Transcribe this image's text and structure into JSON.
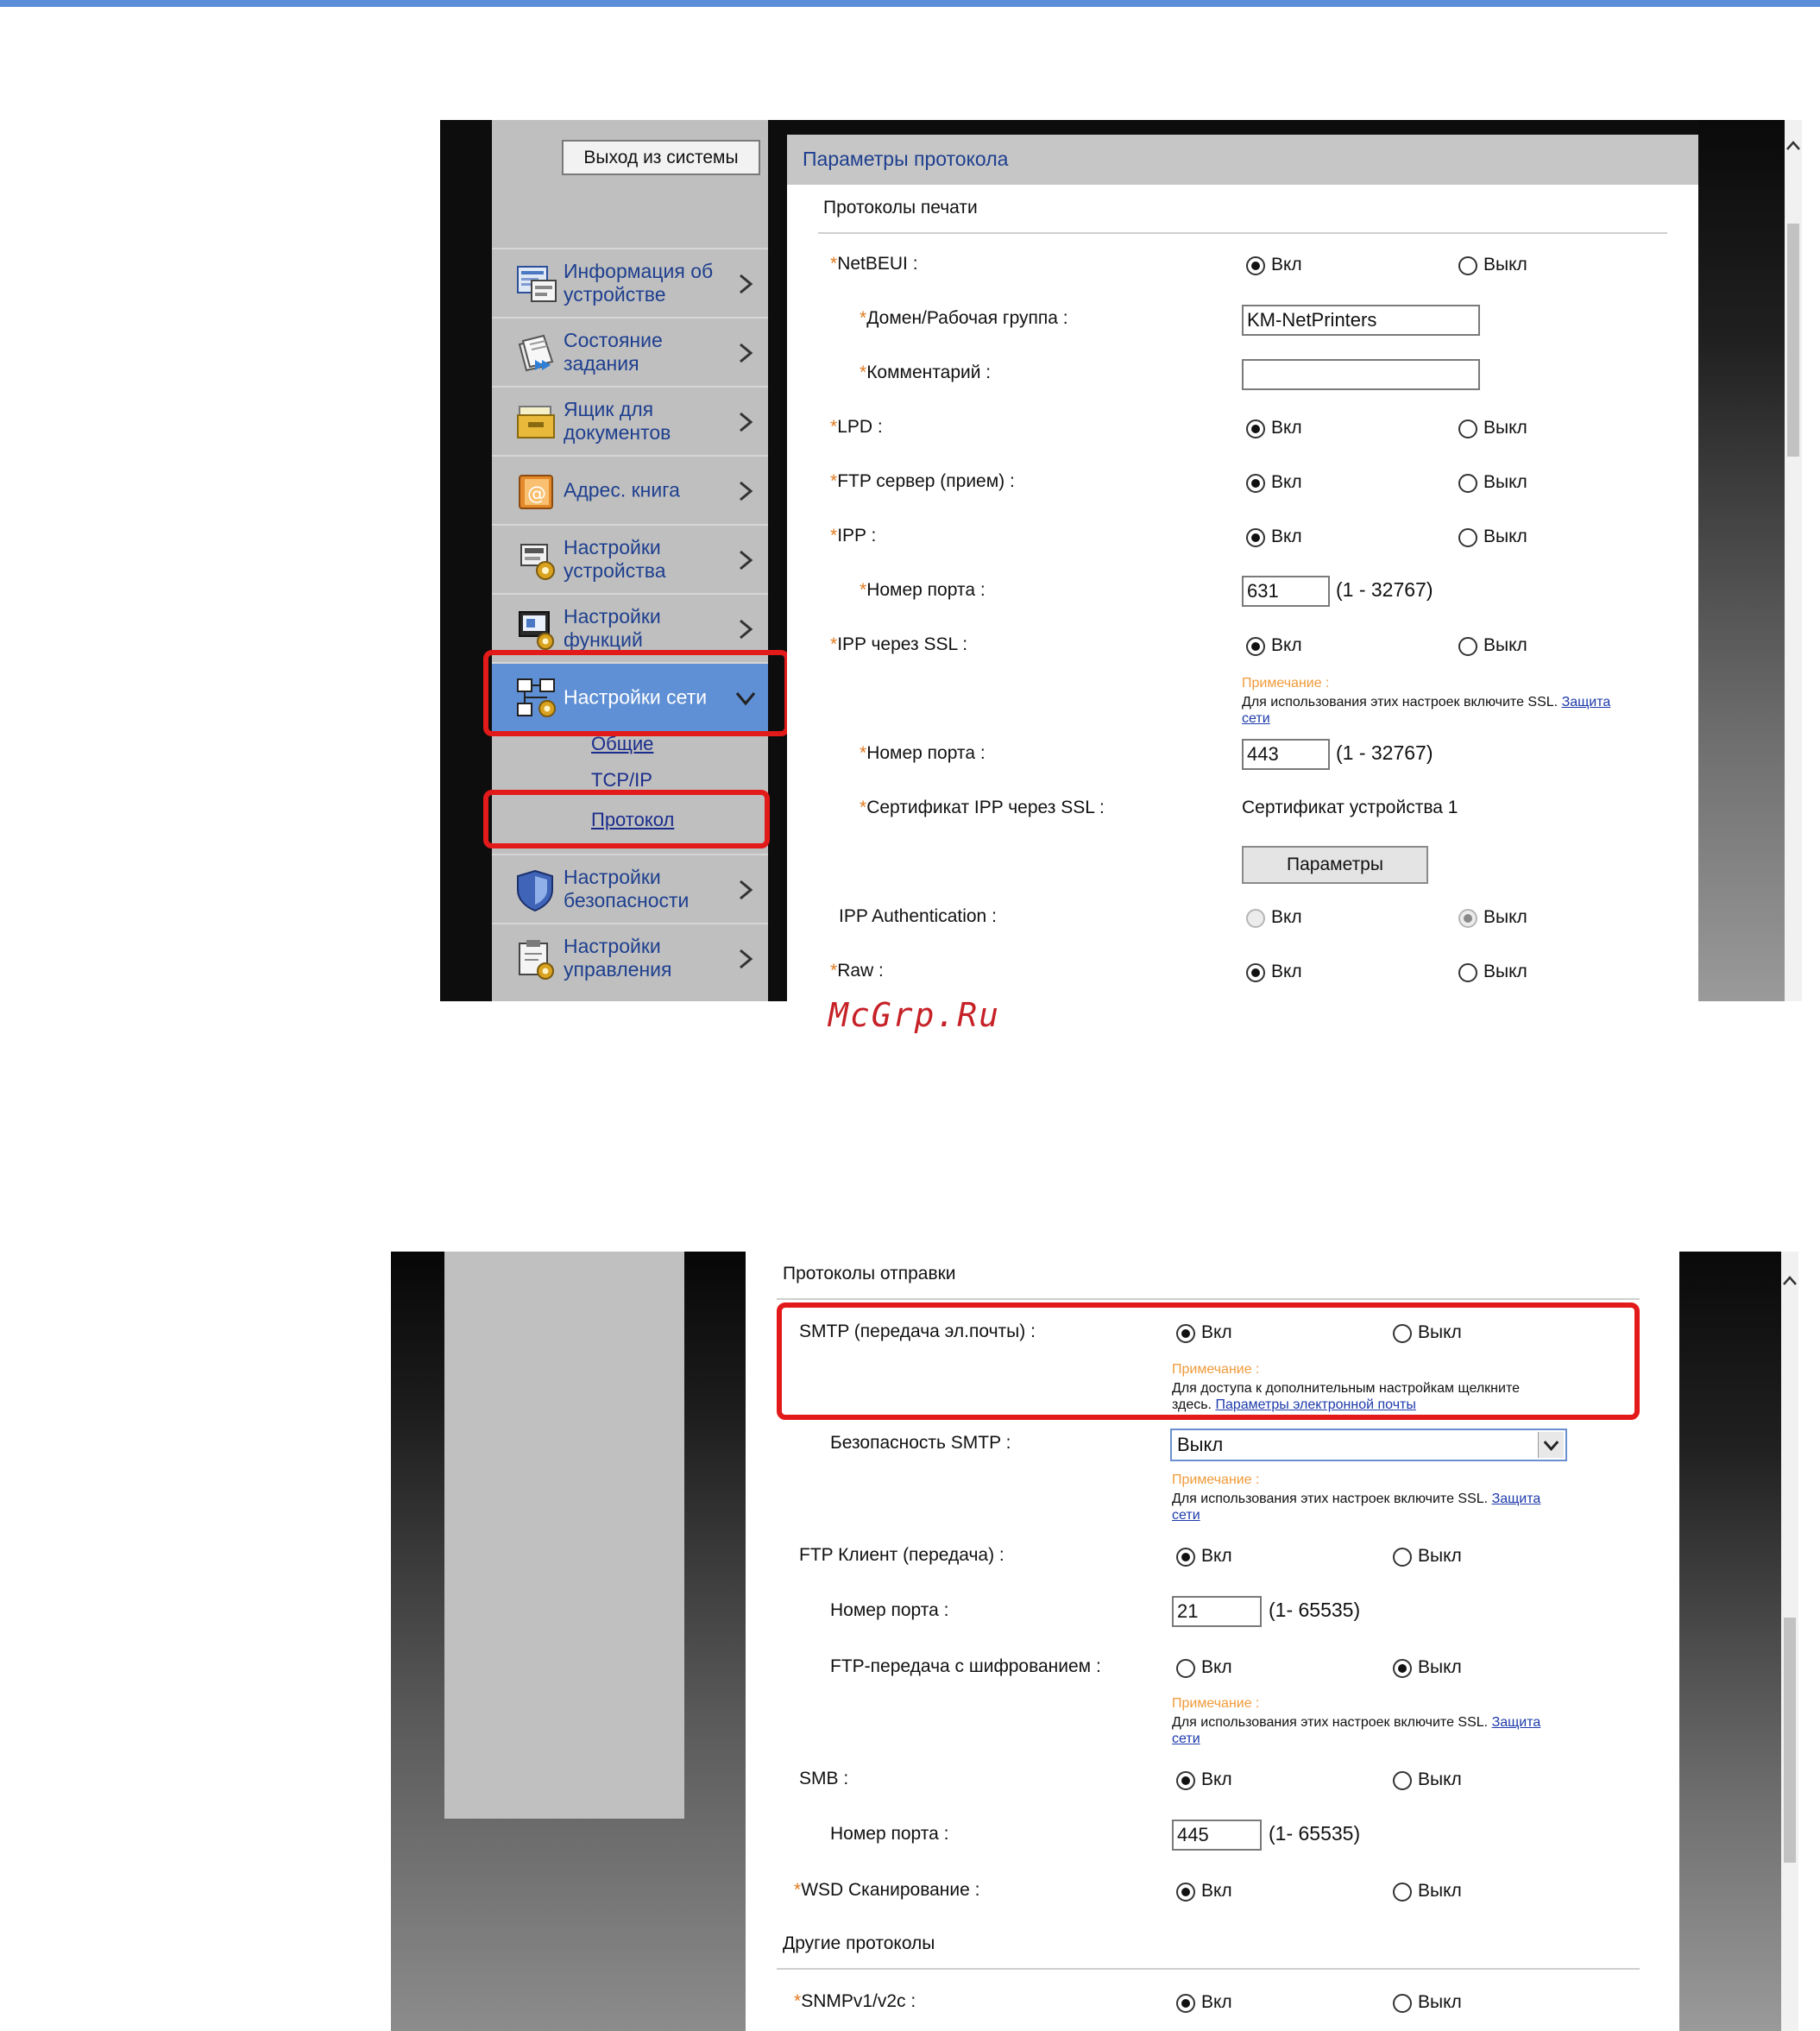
{
  "watermark": "McGrp.Ru",
  "shot1": {
    "logout_button": "Выход из системы",
    "nav": [
      {
        "label": "Информация об\nустройстве",
        "icon": "device-info-icon"
      },
      {
        "label": "Состояние\nзадания",
        "icon": "job-status-icon"
      },
      {
        "label": "Ящик для\nдокументов",
        "icon": "document-box-icon"
      },
      {
        "label": "Адрес. книга",
        "icon": "address-book-icon"
      },
      {
        "label": "Настройки\nустройства",
        "icon": "device-settings-icon"
      },
      {
        "label": "Настройки\nфункций",
        "icon": "function-settings-icon"
      },
      {
        "label": "Настройки сети",
        "icon": "network-settings-icon",
        "active": true
      },
      {
        "label": "Настройки\nбезопасности",
        "icon": "security-settings-icon"
      },
      {
        "label": "Настройки\nуправления",
        "icon": "management-settings-icon"
      }
    ],
    "subnav": [
      "Общие",
      "TCP/IP",
      "Протокол"
    ],
    "panel_title": "Параметры протокола",
    "section_title": "Протоколы печати",
    "on_label": "Вкл",
    "off_label": "Выкл",
    "rows": {
      "netbeui": "NetBEUI :",
      "domain": "Домен/Рабочая группа :",
      "domain_value": "KM-NetPrinters",
      "comment": "Комментарий :",
      "comment_value": "",
      "lpd": "LPD :",
      "ftp_server": "FTP сервер (прием) :",
      "ipp": "IPP :",
      "ipp_port": "Номер порта :",
      "ipp_port_value": "631",
      "ipp_port_range": "(1 - 32767)",
      "ipp_ssl": "IPP через SSL :",
      "note_head": "Примечание :",
      "ssl_note_text": "Для использования этих настроек включите SSL.",
      "ssl_note_link1": "Защита",
      "ssl_note_link2": "сети",
      "ipp_ssl_port": "Номер порта :",
      "ipp_ssl_port_value": "443",
      "ipp_ssl_port_range": "(1 - 32767)",
      "ipp_ssl_cert": "Сертификат IPP через SSL :",
      "ipp_ssl_cert_value": "Сертификат устройства 1",
      "params_button": "Параметры",
      "ipp_auth": "IPP Authentication :",
      "raw": "Raw :"
    }
  },
  "shot2": {
    "section_send": "Протоколы отправки",
    "section_other": "Другие протоколы",
    "on_label": "Вкл",
    "off_label": "Выкл",
    "note_head": "Примечание :",
    "rows": {
      "smtp": "SMTP (передача эл.почты) :",
      "smtp_note_text1": "Для доступа к дополнительным настройкам щелкните",
      "smtp_note_text2": "здесь.",
      "smtp_note_link": "Параметры электронной почты",
      "smtp_security": "Безопасность SMTP :",
      "smtp_security_value": "Выкл",
      "ssl_note_text": "Для использования этих настроек включите SSL.",
      "ssl_note_link1": "Защита",
      "ssl_note_link2": "сети",
      "ftp_client": "FTP Клиент (передача) :",
      "ftp_port": "Номер порта :",
      "ftp_port_value": "21",
      "ftp_port_range": "(1- 65535)",
      "ftp_encrypt": "FTP-передача с шифрованием :",
      "smb": "SMB :",
      "smb_port": "Номер порта :",
      "smb_port_value": "445",
      "smb_port_range": "(1- 65535)",
      "wsd": "WSD Сканирование :",
      "snmp": "SNMPv1/v2c :"
    }
  }
}
